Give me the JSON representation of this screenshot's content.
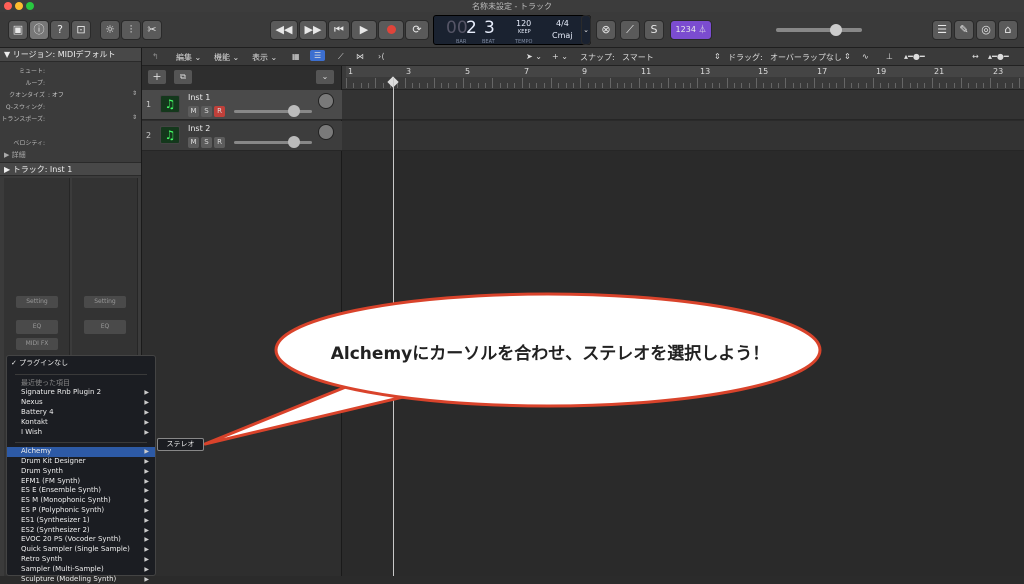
{
  "window": {
    "title": "名称未設定 - トラック",
    "colors": {
      "close": "#ff5f57",
      "min": "#febc2e",
      "max": "#28c840"
    }
  },
  "toolbar": {
    "lcd": {
      "bar": "2",
      "beat": "3",
      "bar_caption": "BAR",
      "beat_caption": "BEAT",
      "tempo": "120",
      "keep": "KEEP",
      "tempo_caption": "TEMPO",
      "sig": "4/4",
      "key": "Cmaj"
    },
    "count_in": "1234"
  },
  "inspector": {
    "region_header": "▼ リージョン: MIDIデフォルト",
    "rows": [
      {
        "label": "ミュート:",
        "value": ""
      },
      {
        "label": "ループ:",
        "value": ""
      },
      {
        "label": "クオンタイズ",
        "value": ": オフ"
      },
      {
        "label": "Q-スウィング:",
        "value": ""
      },
      {
        "label": "トランスポーズ:",
        "value": ""
      },
      {
        "label": "ベロシティ:",
        "value": ""
      }
    ],
    "detail": "▶ 詳細",
    "track_header": "▶ トラック:  Inst 1",
    "strip_buttons": {
      "setting": "Setting",
      "eq": "EQ",
      "midifx": "MIDI FX"
    }
  },
  "header": {
    "edit": "編集",
    "function": "機能",
    "view": "表示",
    "snap_label": "スナップ:",
    "snap_value": "スマート",
    "drag_label": "ドラッグ:",
    "drag_value": "オーバーラップなし"
  },
  "tracks": [
    {
      "num": "1",
      "name": "Inst 1",
      "mute": "M",
      "solo": "S",
      "rec": "R"
    },
    {
      "num": "2",
      "name": "Inst 2",
      "mute": "M",
      "solo": "S",
      "rec": "R"
    }
  ],
  "ruler": [
    "1",
    "3",
    "5",
    "7",
    "9",
    "11",
    "13",
    "15",
    "17",
    "19",
    "21",
    "23"
  ],
  "menu": {
    "items": [
      {
        "label": "✓ プラグインなし",
        "arrow": "",
        "style": ""
      },
      {
        "label": "",
        "arrow": "",
        "style": ""
      },
      {
        "label": "最近使った項目",
        "arrow": "",
        "style": "dim"
      },
      {
        "label": "Signature Rnb Plugin 2",
        "arrow": "▶",
        "style": ""
      },
      {
        "label": "Nexus",
        "arrow": "▶",
        "style": ""
      },
      {
        "label": "Battery 4",
        "arrow": "▶",
        "style": ""
      },
      {
        "label": "Kontakt",
        "arrow": "▶",
        "style": ""
      },
      {
        "label": "I Wish",
        "arrow": "▶",
        "style": ""
      },
      {
        "label": "",
        "arrow": "",
        "style": ""
      },
      {
        "label": "Alchemy",
        "arrow": "▶",
        "style": "sel"
      },
      {
        "label": "Drum Kit Designer",
        "arrow": "▶",
        "style": ""
      },
      {
        "label": "Drum Synth",
        "arrow": "▶",
        "style": ""
      },
      {
        "label": "EFM1  (FM Synth)",
        "arrow": "▶",
        "style": ""
      },
      {
        "label": "ES E  (Ensemble Synth)",
        "arrow": "▶",
        "style": ""
      },
      {
        "label": "ES M  (Monophonic Synth)",
        "arrow": "▶",
        "style": ""
      },
      {
        "label": "ES P  (Polyphonic Synth)",
        "arrow": "▶",
        "style": ""
      },
      {
        "label": "ES1  (Synthesizer 1)",
        "arrow": "▶",
        "style": ""
      },
      {
        "label": "ES2  (Synthesizer 2)",
        "arrow": "▶",
        "style": ""
      },
      {
        "label": "EVOC 20 PS  (Vocoder Synth)",
        "arrow": "▶",
        "style": ""
      },
      {
        "label": "Quick Sampler (Single Sample)",
        "arrow": "▶",
        "style": ""
      },
      {
        "label": "Retro Synth",
        "arrow": "▶",
        "style": ""
      },
      {
        "label": "Sampler (Multi-Sample)",
        "arrow": "▶",
        "style": ""
      },
      {
        "label": "Sculpture  (Modeling Synth)",
        "arrow": "▶",
        "style": ""
      }
    ],
    "submenu": "ステレオ"
  },
  "callout": {
    "text": "Alchemyにカーソルを合わせ、ステレオを選択しよう！",
    "fill": "#ffffff",
    "stroke": "#d9432b"
  }
}
